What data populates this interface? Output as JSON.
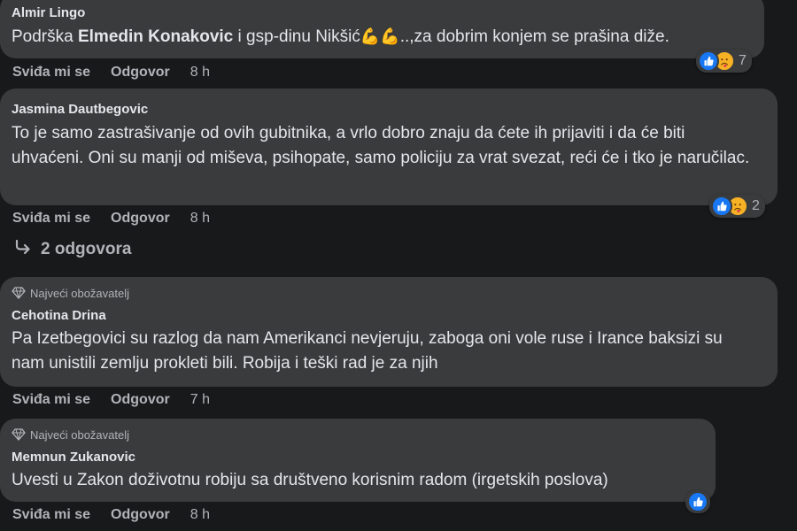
{
  "comments": [
    {
      "author": "Almir Lingo",
      "text_parts": [
        "Podrška ",
        "Elmedin Konakovic",
        " i gsp-dinu Nikšić",
        "💪💪",
        "..,za dobrim konjem se prašina diže."
      ],
      "like_label": "Sviđa mi se",
      "reply_label": "Odgovor",
      "time": "8 h",
      "reaction_count": "7"
    },
    {
      "author": "Jasmina Dautbegovic",
      "text": "To je samo zastrašivanje od ovih gubitnika, a vrlo dobro znaju da ćete ih prijaviti i da će biti uhvaćeni. Oni su manji od miševa, psihopate, samo policiju za vrat svezat, reći će i tko je naručilac.",
      "like_label": "Sviđa mi se",
      "reply_label": "Odgovor",
      "time": "8 h",
      "reaction_count": "2",
      "replies_label": "2 odgovora"
    },
    {
      "badge": "Najveći obožavatelj",
      "author": "Cehotina Drina",
      "text": "Pa Izetbegovici su razlog da nam Amerikanci nevjeruju, zaboga oni vole ruse i Irance baksizi su nam unistili zemlju prokleti bili. Robija i teški rad je za njih",
      "like_label": "Sviđa mi se",
      "reply_label": "Odgovor",
      "time": "7 h"
    },
    {
      "badge": "Najveći obožavatelj",
      "author": "Memnun Zukanovic",
      "text": "Uvesti u Zakon doživotnu robiju sa društveno korisnim radom (irgetskih poslova)",
      "like_label": "Sviđa mi se",
      "reply_label": "Odgovor",
      "time": "8 h"
    }
  ],
  "icons": {
    "like": "like-reaction-icon",
    "care": "care-reaction-icon",
    "reply_arrow": "reply-arrow-icon",
    "badge": "diamond-icon"
  },
  "colors": {
    "background": "#18191a",
    "bubble": "#3a3b3c",
    "text": "#e4e6eb",
    "secondary": "#b0b3b8",
    "like_blue": "#1877f2",
    "care_yellow": "#f7b125"
  }
}
